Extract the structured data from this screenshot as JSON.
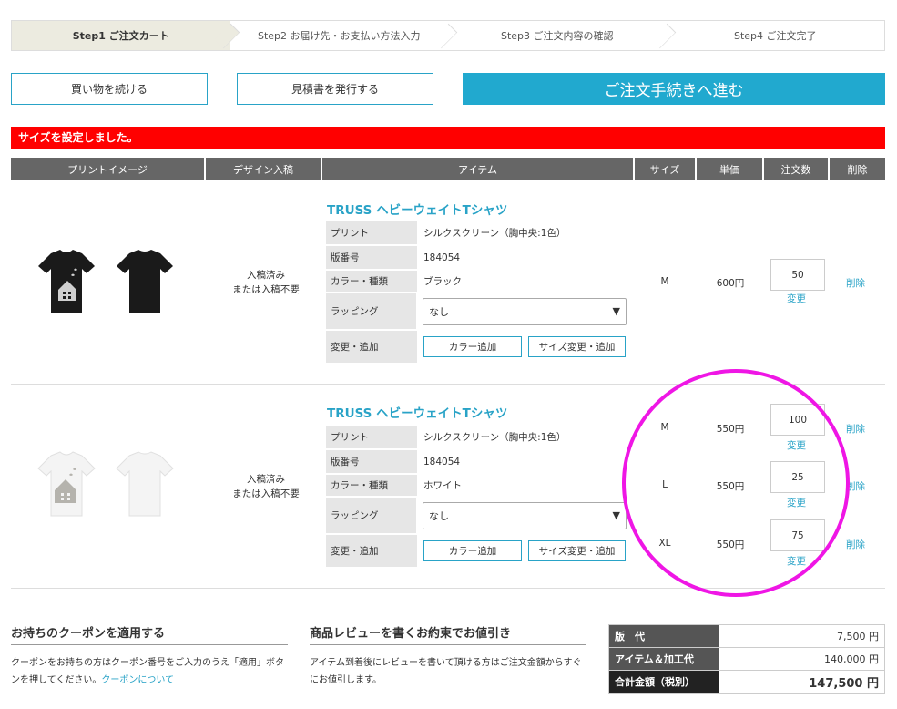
{
  "steps": [
    "Step1 ご注文カート",
    "Step2 お届け先・お支払い方法入力",
    "Step3 ご注文内容の確認",
    "Step4 ご注文完了"
  ],
  "buttons": {
    "continue": "買い物を続ける",
    "quote": "見積書を発行する",
    "checkout": "ご注文手続きへ進む"
  },
  "notice": "サイズを設定しました。",
  "table_headers": [
    "プリントイメージ",
    "デザイン入稿",
    "アイテム",
    "サイズ",
    "単価",
    "注文数",
    "削除"
  ],
  "labels": {
    "print": "プリント",
    "plate": "版番号",
    "color": "カラー・種類",
    "wrapping": "ラッピング",
    "change": "変更・追加",
    "color_add": "カラー追加",
    "size_change": "サイズ変更・追加",
    "update": "変更",
    "delete": "削除"
  },
  "items": [
    {
      "design_status_1": "入稿済み",
      "design_status_2": "または入稿不要",
      "title": "TRUSS ヘビーウェイトTシャツ",
      "print": "シルクスクリーン（胸中央:1色）",
      "plate": "184054",
      "color": "ブラック",
      "wrapping": "なし",
      "shirt_color": "#1a1a1a",
      "lines": [
        {
          "size": "M",
          "price": "600円",
          "qty": "50"
        }
      ]
    },
    {
      "design_status_1": "入稿済み",
      "design_status_2": "または入稿不要",
      "title": "TRUSS ヘビーウェイトTシャツ",
      "print": "シルクスクリーン（胸中央:1色）",
      "plate": "184054",
      "color": "ホワイト",
      "wrapping": "なし",
      "shirt_color": "#f4f4f4",
      "lines": [
        {
          "size": "M",
          "price": "550円",
          "qty": "100"
        },
        {
          "size": "L",
          "price": "550円",
          "qty": "25"
        },
        {
          "size": "XL",
          "price": "550円",
          "qty": "75"
        }
      ]
    }
  ],
  "coupon": {
    "title": "お持ちのクーポンを適用する",
    "desc1": "クーポンをお持ちの方はクーポン番号をご入力のうえ「適用」ボタ",
    "desc2": "ンを押してください。",
    "link": "クーポンについて"
  },
  "review": {
    "title": "商品レビューを書くお約束でお値引き",
    "desc1": "アイテム到着後にレビューを書いて頂ける方はご注文金額からすぐ",
    "desc2": "にお値引します。"
  },
  "summary": {
    "label1": "版　代",
    "value1": "7,500 円",
    "label2": "アイテム＆加工代",
    "value2": "140,000 円",
    "label3": "合計金額（税別）",
    "value3": "147,500 円"
  },
  "colors": {
    "accent": "#21a9cf",
    "notice": "#ff0000",
    "annotation": "#ef16e5"
  }
}
